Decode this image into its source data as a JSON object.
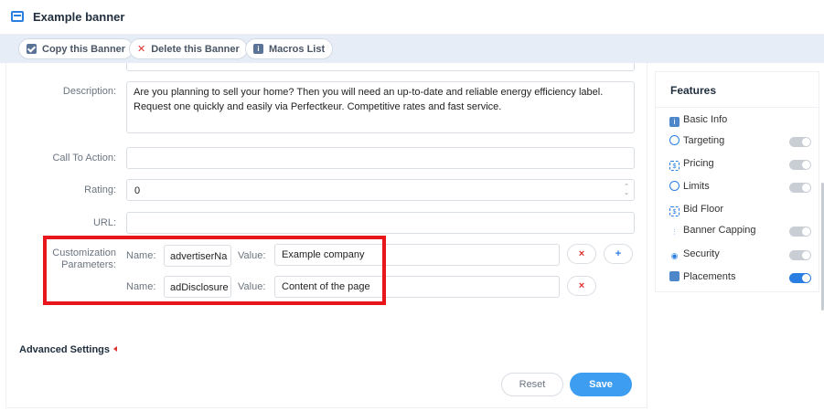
{
  "header": {
    "title": "Example banner"
  },
  "toolbar": {
    "copy_label": "Copy this Banner",
    "delete_label": "Delete this Banner",
    "macros_label": "Macros List"
  },
  "form": {
    "description_label": "Description:",
    "description_value": "Are you planning to sell your home? Then you will need an up-to-date and reliable energy efficiency label. Request one quickly and easily via Perfectkeur. Competitive rates and fast service.",
    "cta_label": "Call To Action:",
    "cta_value": "",
    "rating_label": "Rating:",
    "rating_value": "0",
    "url_label": "URL:",
    "url_value": "",
    "custom_label": "Customization Parameters:",
    "name_label": "Name:",
    "value_label": "Value:",
    "params": [
      {
        "name": "advertiserNa",
        "value": "Example company"
      },
      {
        "name": "adDisclosure",
        "value": "Content of the page"
      }
    ],
    "remove_glyph": "×",
    "add_glyph": "+"
  },
  "advanced": {
    "label": "Advanced Settings"
  },
  "actions": {
    "reset_label": "Reset",
    "save_label": "Save"
  },
  "features": {
    "title": "Features",
    "items": [
      {
        "label": "Basic Info",
        "icon": "info-icon",
        "toggle": null
      },
      {
        "label": "Targeting",
        "icon": "target-icon",
        "toggle": false
      },
      {
        "label": "Pricing",
        "icon": "pricing-icon",
        "toggle": false
      },
      {
        "label": "Limits",
        "icon": "clock-icon",
        "toggle": false
      },
      {
        "label": "Bid Floor",
        "icon": "bid-icon",
        "toggle": null
      },
      {
        "label": "Banner Capping",
        "icon": "sliders-icon",
        "toggle": false
      },
      {
        "label": "Security",
        "icon": "eye-icon",
        "toggle": false
      },
      {
        "label": "Placements",
        "icon": "placement-icon",
        "toggle": true
      }
    ]
  },
  "colors": {
    "accent": "#2a7de1",
    "save": "#3d9df0",
    "danger": "#e0322e",
    "highlight": "#e8161b"
  }
}
